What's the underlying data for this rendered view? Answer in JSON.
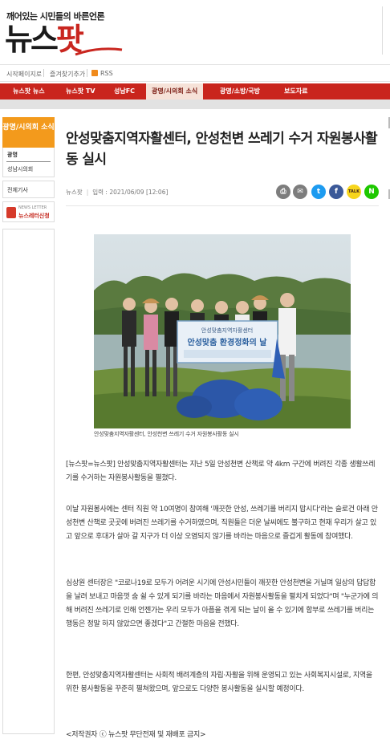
{
  "header": {
    "slogan": "깨어있는 시민들의 바른언론",
    "logo_main": "뉴스",
    "logo_accent": "팟"
  },
  "util_bar": {
    "items": [
      "시작페이지로",
      "즐겨찾기추가",
      "RSS"
    ]
  },
  "nav": {
    "items": [
      "뉴스팟 뉴스",
      "뉴스팟 TV",
      "성남FC",
      "광명/시의회 소식",
      "광명/소방/국방",
      "보도자료"
    ],
    "active_index": 3
  },
  "sidebar": {
    "heading": "광명/시의회 소식",
    "items": [
      "광명",
      "성남시의회"
    ],
    "all_articles": "전체기사",
    "banner_small": "NEWS LETTER",
    "banner_big": "뉴스레터신청"
  },
  "article": {
    "title": "안성맞춤지역자활센터, 안성천변 쓰레기 수거 자원봉사활동 실시",
    "source": "뉴스팟",
    "date": "입력 : 2021/06/09 [12:06]",
    "share_icons": [
      "print-icon",
      "email-icon",
      "twitter-icon",
      "facebook-icon",
      "kakaotalk-icon",
      "naver-icon"
    ],
    "share_labels": {
      "kakao": "TALK",
      "naver": "N"
    },
    "banner_line1": "안성맞춤지역자활센터",
    "banner_line2": "안성맞춤 환경정화의 날",
    "caption": "안성맞춤지역자활센터, 안성천변 쓰레기 수거 자원봉사활동 실시",
    "paragraphs": [
      "[뉴스팟=뉴스팟] 안성맞춤지역자활센터는 지난 5일 안성천변 산책로 약 4km 구간에 버려진 각종 생활쓰레기를 수거하는 자원봉사활동을 펼쳤다.",
      "이날 자원봉사에는 센터 직원 약 10여명이 참여해 '깨끗한 안성, 쓰레기를 버리지 맙시다'라는 슬로건 아래 안성천변 산책로 곳곳에 버려진 쓰레기를 수거하였으며, 직원들은 더운 날씨에도 불구하고 현재 우리가 살고 있고 앞으로 후대가 살아 갈 지구가 더 이상 오염되지 않기를 바라는 마음으로 즐겁게 활동에 참여했다.",
      "심상원 센터장은 \"코로나19로 모두가 어려운 시기에 안성시민들이 깨끗한 안성천변을 거닐며 일상의 답답함을 날려 보내고 마음껏 숨 쉴 수 있게 되기를 바라는 마음에서 자원봉사활동을 펼치게 되었다\"며 \"누군가에 의해 버려진 쓰레기로 인해 언젠가는 우리 모두가 아픔을 겪게 되는 날이 올 수 있기에 함부로 쓰레기를 버리는 행동은 정말 하지 않았으면 좋겠다\"고 간절한 마음을 전했다.",
      "한편, 안성맞춤지역자활센터는 사회적 배려계층의 자립·자활을 위해 운영되고 있는 사회복지시설로, 지역을 위한 봉사활동을 꾸준히 펼쳐왔으며, 앞으로도 다양한 봉사활동을 실시할 예정이다.",
      "<저작권자 ⓒ 뉴스팟 무단전재 및 재배포 금지>"
    ]
  }
}
